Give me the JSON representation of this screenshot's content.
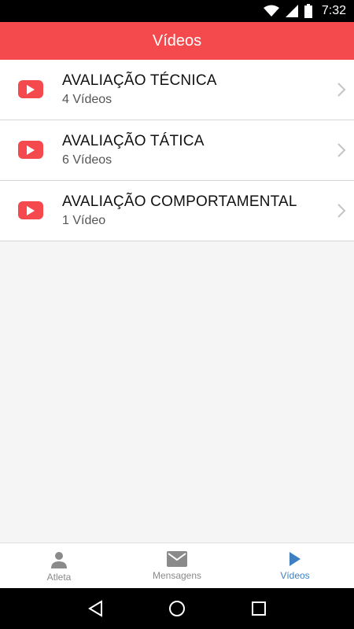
{
  "status_bar": {
    "time": "7:32"
  },
  "app_bar": {
    "title": "Vídeos"
  },
  "list": {
    "items": [
      {
        "title": "AVALIAÇÃO TÉCNICA",
        "subtitle": "4 Vídeos"
      },
      {
        "title": "AVALIAÇÃO TÁTICA",
        "subtitle": "6 Vídeos"
      },
      {
        "title": "AVALIAÇÃO COMPORTAMENTAL",
        "subtitle": "1 Vídeo"
      }
    ]
  },
  "bottom_nav": {
    "items": [
      {
        "label": "Atleta",
        "icon": "person-icon",
        "active": false
      },
      {
        "label": "Mensagens",
        "icon": "mail-icon",
        "active": false
      },
      {
        "label": "Vídeos",
        "icon": "play-icon",
        "active": true
      }
    ]
  },
  "colors": {
    "accent": "#f44a4d",
    "active_tab": "#3d7fc1"
  }
}
